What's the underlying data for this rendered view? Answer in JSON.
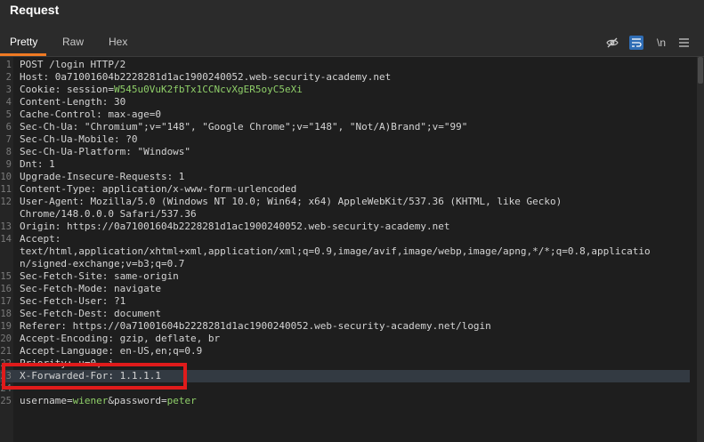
{
  "panel": {
    "title": "Request"
  },
  "tabs": [
    {
      "label": "Pretty",
      "active": true
    },
    {
      "label": "Raw",
      "active": false
    },
    {
      "label": "Hex",
      "active": false
    }
  ],
  "toolbar": {
    "hide_icon": "eye-slash-icon",
    "wrap_icon": "word-wrap-icon",
    "newline_label": "\\n",
    "menu_icon": "hamburger-menu-icon"
  },
  "colors": {
    "accent": "#f07a23",
    "highlight_box": "#e01b1b",
    "value_green": "#8fcf69"
  },
  "lines": [
    {
      "n": "1",
      "text": "POST /login HTTP/2"
    },
    {
      "n": "2",
      "text": "Host: 0a71001604b2228281d1ac1900240052.web-security-academy.net"
    },
    {
      "n": "3",
      "pre": "Cookie: session=",
      "val": "W545u0VuK2fbTx1CCNcvXgER5oyC5eXi"
    },
    {
      "n": "4",
      "text": "Content-Length: 30"
    },
    {
      "n": "5",
      "text": "Cache-Control: max-age=0"
    },
    {
      "n": "6",
      "text": "Sec-Ch-Ua: \"Chromium\";v=\"148\", \"Google Chrome\";v=\"148\", \"Not/A)Brand\";v=\"99\""
    },
    {
      "n": "7",
      "text": "Sec-Ch-Ua-Mobile: ?0"
    },
    {
      "n": "8",
      "text": "Sec-Ch-Ua-Platform: \"Windows\""
    },
    {
      "n": "9",
      "text": "Dnt: 1"
    },
    {
      "n": "10",
      "text": "Upgrade-Insecure-Requests: 1"
    },
    {
      "n": "11",
      "text": "Content-Type: application/x-www-form-urlencoded"
    },
    {
      "n": "12",
      "text": "User-Agent: Mozilla/5.0 (Windows NT 10.0; Win64; x64) AppleWebKit/537.36 (KHTML, like Gecko)"
    },
    {
      "n": "",
      "text": "Chrome/148.0.0.0 Safari/537.36"
    },
    {
      "n": "13",
      "text": "Origin: https://0a71001604b2228281d1ac1900240052.web-security-academy.net"
    },
    {
      "n": "14",
      "text": "Accept:"
    },
    {
      "n": "",
      "text": "text/html,application/xhtml+xml,application/xml;q=0.9,image/avif,image/webp,image/apng,*/*;q=0.8,applicatio"
    },
    {
      "n": "",
      "text": "n/signed-exchange;v=b3;q=0.7"
    },
    {
      "n": "15",
      "text": "Sec-Fetch-Site: same-origin"
    },
    {
      "n": "16",
      "text": "Sec-Fetch-Mode: navigate"
    },
    {
      "n": "17",
      "text": "Sec-Fetch-User: ?1"
    },
    {
      "n": "18",
      "text": "Sec-Fetch-Dest: document"
    },
    {
      "n": "19",
      "text": "Referer: https://0a71001604b2228281d1ac1900240052.web-security-academy.net/login"
    },
    {
      "n": "20",
      "text": "Accept-Encoding: gzip, deflate, br"
    },
    {
      "n": "21",
      "text": "Accept-Language: en-US,en;q=0.9"
    },
    {
      "n": "22",
      "text": "Priority: u=0, i"
    },
    {
      "n": "23",
      "text": "X-Forwarded-For: 1.1.1.1"
    },
    {
      "n": "24",
      "text": ""
    },
    {
      "n": "25",
      "u_key": "username",
      "u_val": "wiener",
      "p_key": "password",
      "p_val": "peter"
    }
  ]
}
